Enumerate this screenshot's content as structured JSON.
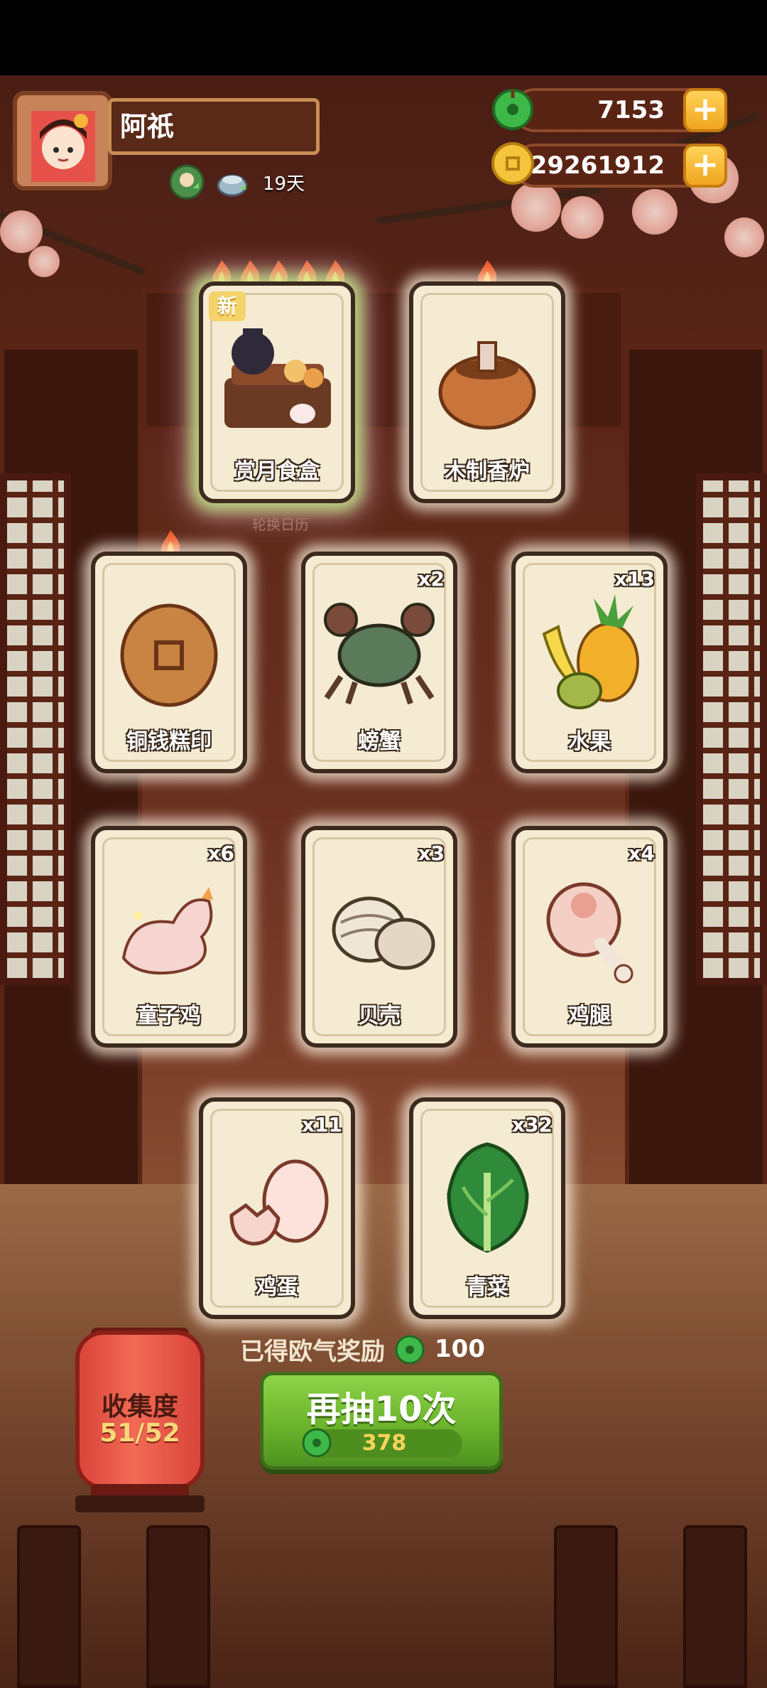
{
  "player": {
    "name": "阿祇",
    "days": "19天"
  },
  "currencies": {
    "jade": {
      "value": "7153",
      "icon": "jade-coin-icon",
      "plus": "+"
    },
    "gold": {
      "value": "29261912",
      "icon": "gold-coin-icon",
      "plus": "+"
    }
  },
  "calendar": {
    "label": "轮换日历"
  },
  "cards": [
    {
      "label": "赏月食盒",
      "count": "",
      "flames": 5,
      "new": "新",
      "icon": "mooncake-food-box-icon"
    },
    {
      "label": "木制香炉",
      "count": "",
      "flames": 1,
      "icon": "wooden-incense-burner-icon"
    },
    {
      "label": "铜钱糕印",
      "count": "",
      "flames": 1,
      "icon": "coin-cake-mold-icon"
    },
    {
      "label": "螃蟹",
      "count": "x2",
      "icon": "crab-icon"
    },
    {
      "label": "水果",
      "count": "x13",
      "icon": "fruit-icon"
    },
    {
      "label": "童子鸡",
      "count": "x6",
      "icon": "spring-chicken-icon"
    },
    {
      "label": "贝壳",
      "count": "x3",
      "icon": "shell-icon"
    },
    {
      "label": "鸡腿",
      "count": "x4",
      "icon": "chicken-leg-icon"
    },
    {
      "label": "鸡蛋",
      "count": "x11",
      "icon": "egg-icon"
    },
    {
      "label": "青菜",
      "count": "x32",
      "icon": "greens-icon"
    }
  ],
  "reward": {
    "text": "已得欧气奖励",
    "amount": "100"
  },
  "draw": {
    "title": "再抽10次",
    "cost": "378"
  },
  "collection": {
    "title": "收集度",
    "value": "51/52"
  },
  "colors": {
    "accent_green": "#6bb42c",
    "lantern_red": "#e0503f",
    "card_bg": "#f5ead2"
  }
}
